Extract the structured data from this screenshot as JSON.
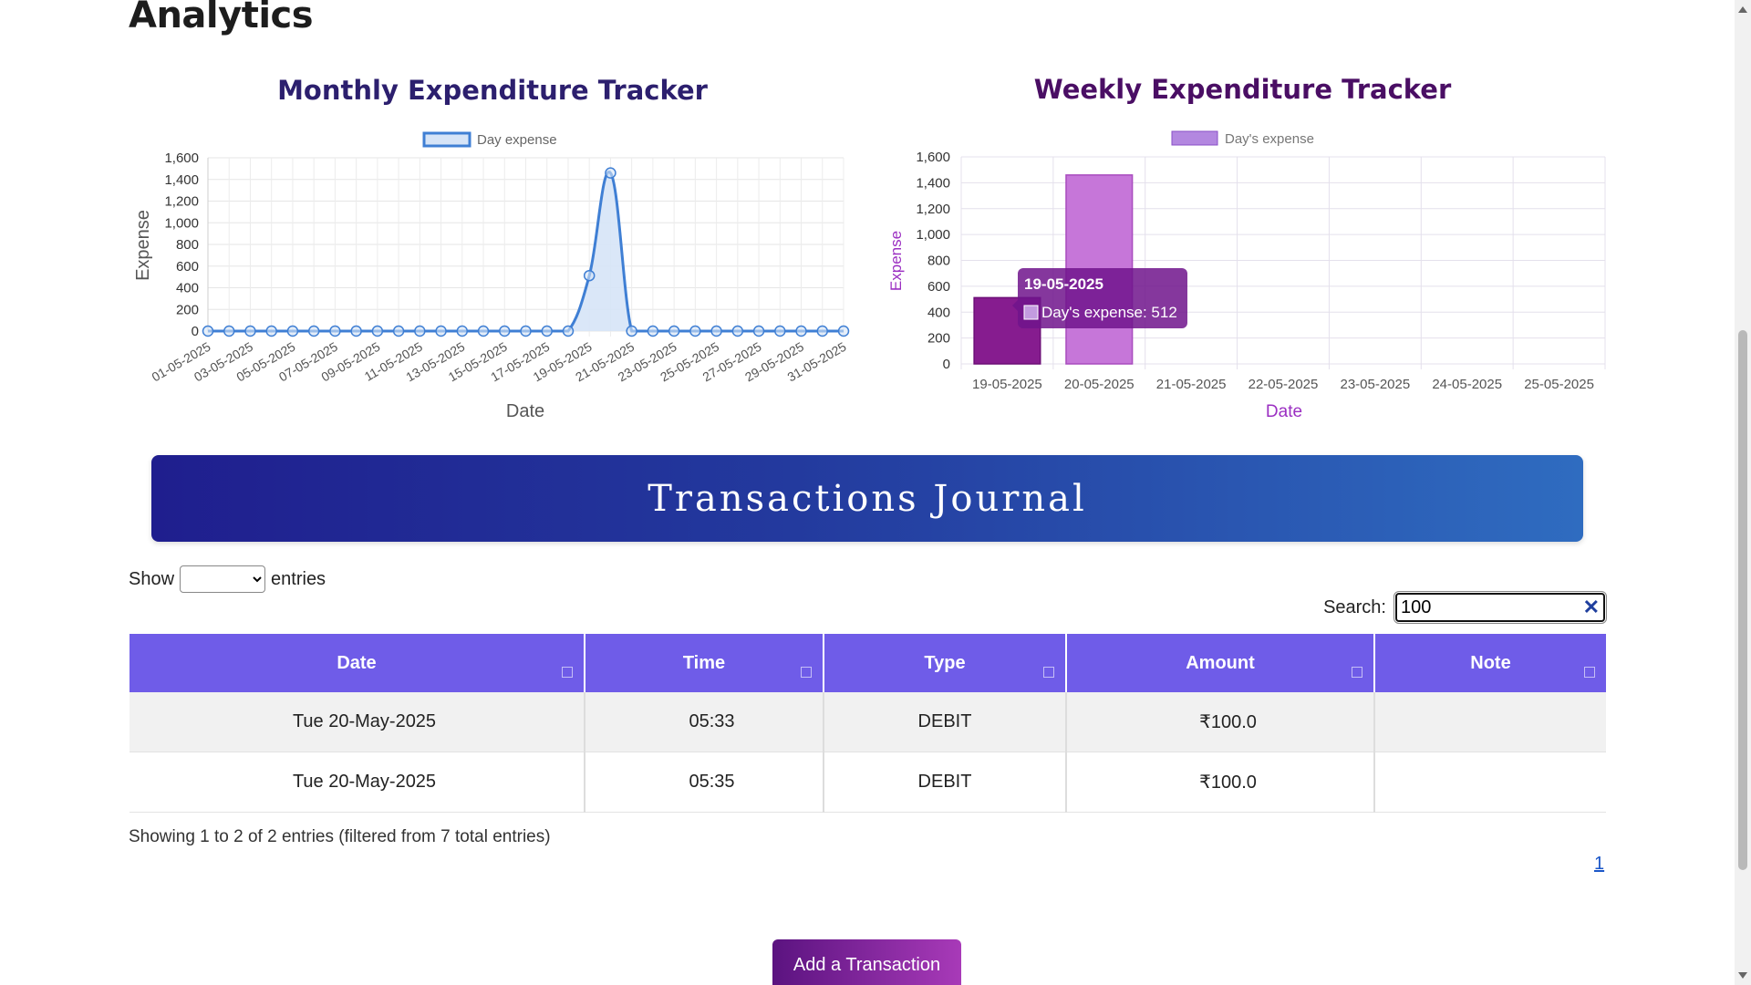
{
  "page": {
    "heading": "Analytics"
  },
  "monthly_chart": {
    "title": "Monthly Expenditure Tracker",
    "legend": "Day expense",
    "xlabel": "Date",
    "ylabel": "Expense",
    "y_ticks": [
      "0",
      "200",
      "400",
      "600",
      "800",
      "1,000",
      "1,200",
      "1,400",
      "1,600"
    ],
    "x_tick_labels": [
      "01-05-2025",
      "03-05-2025",
      "05-05-2025",
      "07-05-2025",
      "09-05-2025",
      "11-05-2025",
      "13-05-2025",
      "15-05-2025",
      "17-05-2025",
      "19-05-2025",
      "21-05-2025",
      "23-05-2025",
      "25-05-2025",
      "27-05-2025",
      "29-05-2025",
      "31-05-2025"
    ],
    "color": "#3f7fd4",
    "fill_color": "#d6e4f7"
  },
  "weekly_chart": {
    "title": "Weekly Expenditure Tracker",
    "legend": "Day's expense",
    "xlabel": "Date",
    "ylabel": "Expense",
    "y_ticks": [
      "0",
      "200",
      "400",
      "600",
      "800",
      "1,000",
      "1,200",
      "1,400",
      "1,600"
    ],
    "bar_color_default": "#c676d9",
    "bar_color_active": "#861c8f",
    "tooltip": {
      "title": "19-05-2025",
      "label": "Day's expense: 512"
    }
  },
  "chart_data": [
    {
      "type": "line",
      "title": "Monthly Expenditure Tracker",
      "xlabel": "Date",
      "ylabel": "Expense",
      "ylim": [
        0,
        1600
      ],
      "series": [
        {
          "name": "Day expense",
          "x": [
            "01-05-2025",
            "02-05-2025",
            "03-05-2025",
            "04-05-2025",
            "05-05-2025",
            "06-05-2025",
            "07-05-2025",
            "08-05-2025",
            "09-05-2025",
            "10-05-2025",
            "11-05-2025",
            "12-05-2025",
            "13-05-2025",
            "14-05-2025",
            "15-05-2025",
            "16-05-2025",
            "17-05-2025",
            "18-05-2025",
            "19-05-2025",
            "20-05-2025",
            "21-05-2025",
            "22-05-2025",
            "23-05-2025",
            "24-05-2025",
            "25-05-2025",
            "26-05-2025",
            "27-05-2025",
            "28-05-2025",
            "29-05-2025",
            "30-05-2025",
            "31-05-2025"
          ],
          "values": [
            0,
            0,
            0,
            0,
            0,
            0,
            0,
            0,
            0,
            0,
            0,
            0,
            0,
            0,
            0,
            0,
            0,
            0,
            512,
            1460,
            0,
            0,
            0,
            0,
            0,
            0,
            0,
            0,
            0,
            0,
            0
          ]
        }
      ],
      "legend": "top-center",
      "grid": true
    },
    {
      "type": "bar",
      "title": "Weekly Expenditure Tracker",
      "xlabel": "Date",
      "ylabel": "Expense",
      "ylim": [
        0,
        1600
      ],
      "categories": [
        "19-05-2025",
        "20-05-2025",
        "21-05-2025",
        "22-05-2025",
        "23-05-2025",
        "24-05-2025",
        "25-05-2025"
      ],
      "series": [
        {
          "name": "Day's expense",
          "values": [
            512,
            1460,
            0,
            0,
            0,
            0,
            0
          ]
        }
      ],
      "legend": "top-center",
      "grid": true
    }
  ],
  "journal": {
    "title": "Transactions Journal",
    "show_label": "Show",
    "entries_label": "entries",
    "search_label": "Search:",
    "search_value": "100",
    "columns": [
      "Date",
      "Time",
      "Type",
      "Amount",
      "Note"
    ],
    "rows": [
      {
        "date": "Tue 20-May-2025",
        "time": "05:33",
        "type": "DEBIT",
        "amount": "₹100.0",
        "note": ""
      },
      {
        "date": "Tue 20-May-2025",
        "time": "05:35",
        "type": "DEBIT",
        "amount": "₹100.0",
        "note": ""
      }
    ],
    "info": "Showing 1 to 2 of 2 entries (filtered from 7 total entries)",
    "page_number": "1"
  },
  "actions": {
    "add_transaction": "Add a Transaction"
  },
  "colors": {
    "title_monthly": "#2c1f6e",
    "title_weekly": "#4a0e64",
    "header_purple": "#6f5ce8",
    "banner_start": "#1f1e8e",
    "banner_end": "#2f6cc0"
  }
}
